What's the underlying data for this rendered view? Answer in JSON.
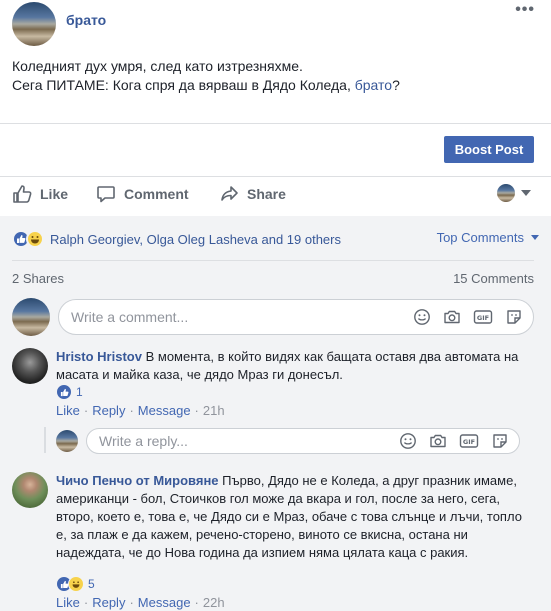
{
  "post": {
    "author": "брато",
    "menu": "•••",
    "text_line1": "Коледният дух умря, след като изтрезняхме.",
    "text_line2_prefix": "Сега ПИТАМЕ: Кога спря да вярваш в Дядо Коледа, ",
    "text_line2_link": "брато",
    "text_line2_suffix": "?"
  },
  "boost_button": "Boost Post",
  "actions": {
    "like": "Like",
    "comment": "Comment",
    "share": "Share"
  },
  "reactions": {
    "summary": "Ralph Georgiev, Olga Oleg Lasheva and 19 others",
    "sort_label": "Top Comments"
  },
  "stats": {
    "shares": "2 Shares",
    "comments": "15 Comments"
  },
  "composer": {
    "placeholder": "Write a comment..."
  },
  "reply_composer": {
    "placeholder": "Write a reply..."
  },
  "comments": [
    {
      "name": "Hristo Hristov",
      "text": "В момента, в който видях как бащата оставя два автомата на масата и майка каза, че дядо Мраз ги донесъл.",
      "reaction_count": "1",
      "like": "Like",
      "reply": "Reply",
      "message": "Message",
      "time": "21h"
    },
    {
      "name": "Чичо Пенчо от Мировяне",
      "text": "Първо, Дядо не е Коледа, а друг празник имаме, американци - бол, Стоичков гол може да вкара и гол, после за него, сега, второ, което е, това е, че Дядо си е Мраз, обаче с това слънце и лъчи, топло е, за плаж е да кажем, речено-сторено, виното се вкисна, остана ни надеждата, че до Нова година да изпием няма цялата каца с ракия.",
      "reaction_count": "5",
      "like": "Like",
      "reply": "Reply",
      "message": "Message",
      "time": "22h"
    }
  ],
  "colors": {
    "link": "#385898",
    "accent": "#4267b2",
    "muted": "#606770",
    "bg_grey": "#f2f3f5"
  }
}
